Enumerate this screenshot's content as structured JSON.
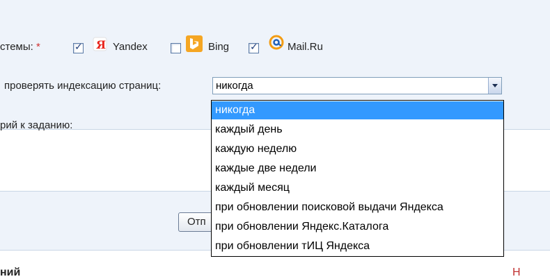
{
  "form": {
    "engines_label": "стемы:",
    "required_mark": "*",
    "engines": [
      {
        "name": "Yandex",
        "checked": true,
        "icon": "yandex-icon"
      },
      {
        "name": "Bing",
        "checked": false,
        "icon": "bing-icon"
      },
      {
        "name": "Mail.Ru",
        "checked": true,
        "icon": "mailru-icon"
      }
    ],
    "frequency_label": "проверять индексацию страниц:",
    "frequency_value": "никогда",
    "comment_label": "рий к заданию:",
    "frequency_options": [
      "никогда",
      "каждый день",
      "каждую неделю",
      "каждые две недели",
      "каждый месяц",
      "при обновлении поисковой выдачи Яндекса",
      "при обновлении Яндекс.Каталога",
      "при обновлении тИЦ Яндекса"
    ],
    "submit_label": "Отп"
  },
  "footer": {
    "heading_fragment": "ний",
    "red_fragment": "Н"
  },
  "colors": {
    "panel": "#eef3fa",
    "selected": "#3399ff",
    "required": "#d03030"
  }
}
